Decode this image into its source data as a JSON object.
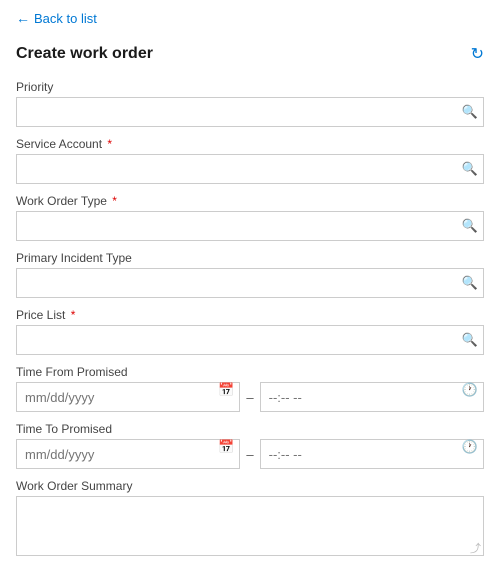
{
  "back": {
    "arrow": "←",
    "label": "Back to list"
  },
  "header": {
    "title": "Create work order",
    "refresh_icon": "↻"
  },
  "fields": {
    "priority": {
      "label": "Priority",
      "placeholder": "",
      "required": false
    },
    "service_account": {
      "label": "Service Account",
      "placeholder": "",
      "required": true
    },
    "work_order_type": {
      "label": "Work Order Type",
      "placeholder": "",
      "required": true
    },
    "primary_incident_type": {
      "label": "Primary Incident Type",
      "placeholder": "",
      "required": false
    },
    "price_list": {
      "label": "Price List",
      "placeholder": "",
      "required": true
    },
    "time_from_promised": {
      "label": "Time From Promised",
      "date_placeholder": "mm/dd/yyyy",
      "time_placeholder": "--:-- --"
    },
    "time_to_promised": {
      "label": "Time To Promised",
      "date_placeholder": "mm/dd/yyyy",
      "time_placeholder": "--:-- --"
    },
    "work_order_summary": {
      "label": "Work Order Summary",
      "placeholder": ""
    }
  },
  "icons": {
    "search": "🔍",
    "calendar": "📅",
    "clock": "🕐",
    "resize": "⤡"
  }
}
